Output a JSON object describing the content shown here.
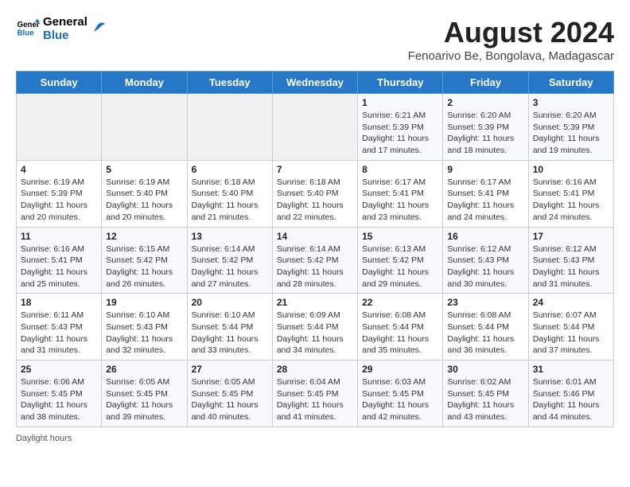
{
  "header": {
    "logo_line1": "General",
    "logo_line2": "Blue",
    "title": "August 2024",
    "subtitle": "Fenoarivo Be, Bongolava, Madagascar"
  },
  "weekdays": [
    "Sunday",
    "Monday",
    "Tuesday",
    "Wednesday",
    "Thursday",
    "Friday",
    "Saturday"
  ],
  "weeks": [
    [
      {
        "day": "",
        "sunrise": "",
        "sunset": "",
        "daylight": ""
      },
      {
        "day": "",
        "sunrise": "",
        "sunset": "",
        "daylight": ""
      },
      {
        "day": "",
        "sunrise": "",
        "sunset": "",
        "daylight": ""
      },
      {
        "day": "",
        "sunrise": "",
        "sunset": "",
        "daylight": ""
      },
      {
        "day": "1",
        "sunrise": "6:21 AM",
        "sunset": "5:39 PM",
        "daylight": "11 hours and 17 minutes."
      },
      {
        "day": "2",
        "sunrise": "6:20 AM",
        "sunset": "5:39 PM",
        "daylight": "11 hours and 18 minutes."
      },
      {
        "day": "3",
        "sunrise": "6:20 AM",
        "sunset": "5:39 PM",
        "daylight": "11 hours and 19 minutes."
      }
    ],
    [
      {
        "day": "4",
        "sunrise": "6:19 AM",
        "sunset": "5:39 PM",
        "daylight": "11 hours and 20 minutes."
      },
      {
        "day": "5",
        "sunrise": "6:19 AM",
        "sunset": "5:40 PM",
        "daylight": "11 hours and 20 minutes."
      },
      {
        "day": "6",
        "sunrise": "6:18 AM",
        "sunset": "5:40 PM",
        "daylight": "11 hours and 21 minutes."
      },
      {
        "day": "7",
        "sunrise": "6:18 AM",
        "sunset": "5:40 PM",
        "daylight": "11 hours and 22 minutes."
      },
      {
        "day": "8",
        "sunrise": "6:17 AM",
        "sunset": "5:41 PM",
        "daylight": "11 hours and 23 minutes."
      },
      {
        "day": "9",
        "sunrise": "6:17 AM",
        "sunset": "5:41 PM",
        "daylight": "11 hours and 24 minutes."
      },
      {
        "day": "10",
        "sunrise": "6:16 AM",
        "sunset": "5:41 PM",
        "daylight": "11 hours and 24 minutes."
      }
    ],
    [
      {
        "day": "11",
        "sunrise": "6:16 AM",
        "sunset": "5:41 PM",
        "daylight": "11 hours and 25 minutes."
      },
      {
        "day": "12",
        "sunrise": "6:15 AM",
        "sunset": "5:42 PM",
        "daylight": "11 hours and 26 minutes."
      },
      {
        "day": "13",
        "sunrise": "6:14 AM",
        "sunset": "5:42 PM",
        "daylight": "11 hours and 27 minutes."
      },
      {
        "day": "14",
        "sunrise": "6:14 AM",
        "sunset": "5:42 PM",
        "daylight": "11 hours and 28 minutes."
      },
      {
        "day": "15",
        "sunrise": "6:13 AM",
        "sunset": "5:42 PM",
        "daylight": "11 hours and 29 minutes."
      },
      {
        "day": "16",
        "sunrise": "6:12 AM",
        "sunset": "5:43 PM",
        "daylight": "11 hours and 30 minutes."
      },
      {
        "day": "17",
        "sunrise": "6:12 AM",
        "sunset": "5:43 PM",
        "daylight": "11 hours and 31 minutes."
      }
    ],
    [
      {
        "day": "18",
        "sunrise": "6:11 AM",
        "sunset": "5:43 PM",
        "daylight": "11 hours and 31 minutes."
      },
      {
        "day": "19",
        "sunrise": "6:10 AM",
        "sunset": "5:43 PM",
        "daylight": "11 hours and 32 minutes."
      },
      {
        "day": "20",
        "sunrise": "6:10 AM",
        "sunset": "5:44 PM",
        "daylight": "11 hours and 33 minutes."
      },
      {
        "day": "21",
        "sunrise": "6:09 AM",
        "sunset": "5:44 PM",
        "daylight": "11 hours and 34 minutes."
      },
      {
        "day": "22",
        "sunrise": "6:08 AM",
        "sunset": "5:44 PM",
        "daylight": "11 hours and 35 minutes."
      },
      {
        "day": "23",
        "sunrise": "6:08 AM",
        "sunset": "5:44 PM",
        "daylight": "11 hours and 36 minutes."
      },
      {
        "day": "24",
        "sunrise": "6:07 AM",
        "sunset": "5:44 PM",
        "daylight": "11 hours and 37 minutes."
      }
    ],
    [
      {
        "day": "25",
        "sunrise": "6:06 AM",
        "sunset": "5:45 PM",
        "daylight": "11 hours and 38 minutes."
      },
      {
        "day": "26",
        "sunrise": "6:05 AM",
        "sunset": "5:45 PM",
        "daylight": "11 hours and 39 minutes."
      },
      {
        "day": "27",
        "sunrise": "6:05 AM",
        "sunset": "5:45 PM",
        "daylight": "11 hours and 40 minutes."
      },
      {
        "day": "28",
        "sunrise": "6:04 AM",
        "sunset": "5:45 PM",
        "daylight": "11 hours and 41 minutes."
      },
      {
        "day": "29",
        "sunrise": "6:03 AM",
        "sunset": "5:45 PM",
        "daylight": "11 hours and 42 minutes."
      },
      {
        "day": "30",
        "sunrise": "6:02 AM",
        "sunset": "5:45 PM",
        "daylight": "11 hours and 43 minutes."
      },
      {
        "day": "31",
        "sunrise": "6:01 AM",
        "sunset": "5:46 PM",
        "daylight": "11 hours and 44 minutes."
      }
    ]
  ],
  "footer": {
    "daylight_label": "Daylight hours"
  }
}
